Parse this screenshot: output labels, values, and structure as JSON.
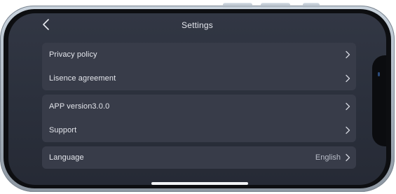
{
  "header": {
    "title": "Settings"
  },
  "groups": [
    {
      "rows": [
        {
          "label": "Privacy policy"
        },
        {
          "label": "Lisence agreement"
        }
      ]
    },
    {
      "rows": [
        {
          "label": "APP version3.0.0"
        },
        {
          "label": "Support"
        }
      ]
    },
    {
      "rows": [
        {
          "label": "Language",
          "value": "English"
        }
      ]
    }
  ],
  "icons": {
    "back": "chevron-left-icon",
    "row_arrow": "chevron-right-icon"
  },
  "colors": {
    "screen_background": "#2d3240",
    "group_background": "#383c49",
    "text_primary": "#e4e6ec",
    "text_secondary": "#b9bdc8",
    "frame": "#b3bdc8"
  }
}
